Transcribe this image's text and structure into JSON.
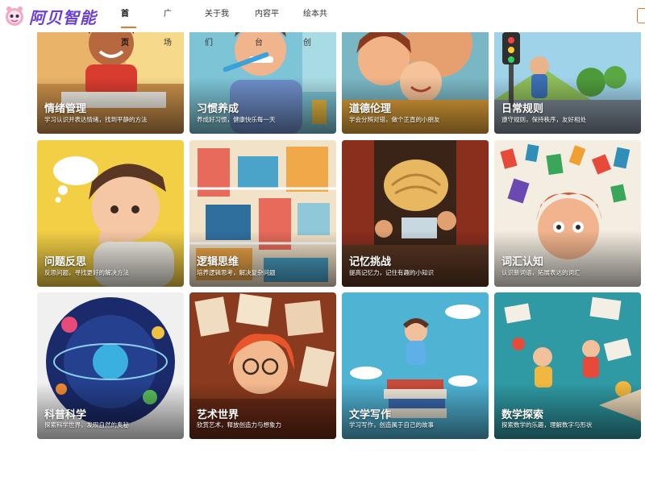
{
  "header": {
    "logo_text": "阿贝智能",
    "logo_icon": "mascot-icon",
    "accent_color": "#e8772e",
    "brand_color": "#6b3fd6",
    "nav": [
      {
        "label": "首页",
        "active": true
      },
      {
        "label": "广场",
        "active": false
      },
      {
        "label": "关于我们",
        "active": false
      },
      {
        "label": "内容平台",
        "active": false
      },
      {
        "label": "绘本共创",
        "active": false
      }
    ]
  },
  "cards": [
    {
      "title": "情绪管理",
      "subtitle": "学习认识并表达情绪，找到平静的方法",
      "theme": "emotion"
    },
    {
      "title": "习惯养成",
      "subtitle": "养成好习惯，健康快乐每一天",
      "theme": "habit"
    },
    {
      "title": "道德伦理",
      "subtitle": "学会分辨对错，做个正直的小朋友",
      "theme": "ethics"
    },
    {
      "title": "日常规则",
      "subtitle": "遵守规则，保持秩序，友好相处",
      "theme": "rules"
    },
    {
      "title": "问题反思",
      "subtitle": "反思问题，寻找更好的解决方法",
      "theme": "reflect"
    },
    {
      "title": "逻辑思维",
      "subtitle": "培养逻辑思考，解决复杂问题",
      "theme": "logic"
    },
    {
      "title": "记忆挑战",
      "subtitle": "提高记忆力，记住有趣的小知识",
      "theme": "memory"
    },
    {
      "title": "词汇认知",
      "subtitle": "认识新词语，拓展表达的词汇",
      "theme": "vocab"
    },
    {
      "title": "科普科学",
      "subtitle": "探索科学世界，发现自然的奥秘",
      "theme": "science"
    },
    {
      "title": "艺术世界",
      "subtitle": "欣赏艺术，释放创造力与想象力",
      "theme": "art"
    },
    {
      "title": "文学写作",
      "subtitle": "学习写作，创造属于自己的故事",
      "theme": "writing"
    },
    {
      "title": "数学探索",
      "subtitle": "探索数学的乐趣，理解数字与形状",
      "theme": "math"
    }
  ]
}
